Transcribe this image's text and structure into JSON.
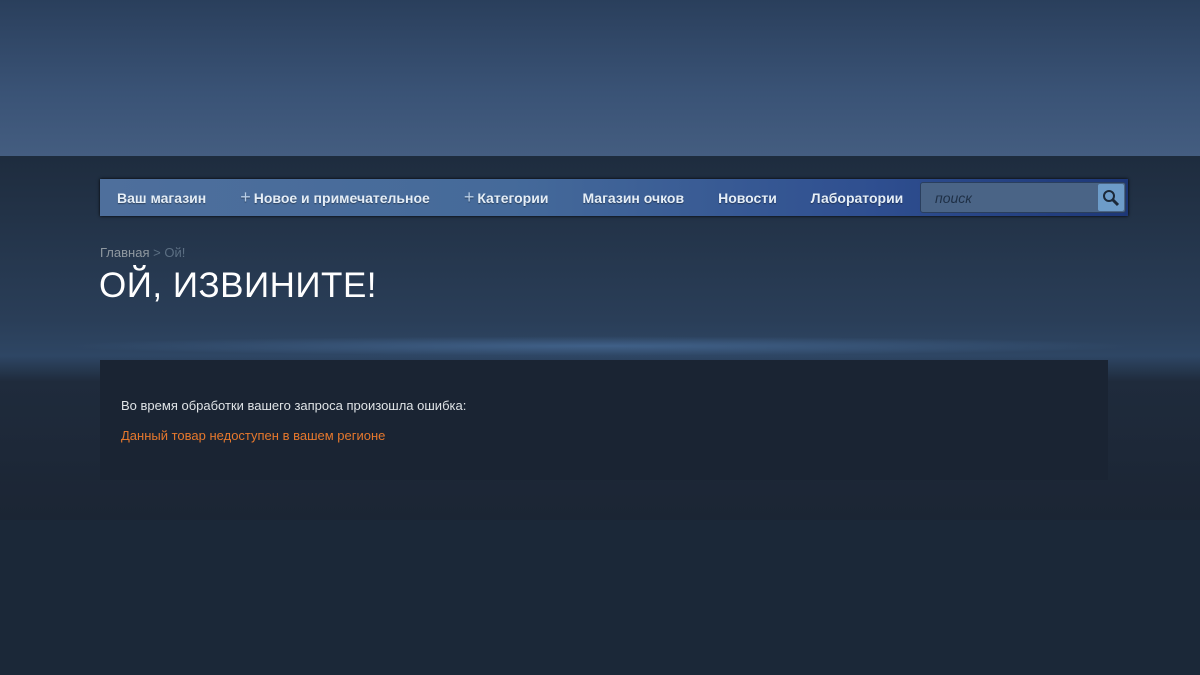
{
  "nav": {
    "items": [
      {
        "label": "Ваш магазин",
        "plus": false
      },
      {
        "label": "Новое и примечательное",
        "plus": true
      },
      {
        "label": "Категории",
        "plus": true
      },
      {
        "label": "Магазин очков",
        "plus": false
      },
      {
        "label": "Новости",
        "plus": false
      },
      {
        "label": "Лаборатории",
        "plus": false
      }
    ]
  },
  "search": {
    "placeholder": "поиск",
    "icon": "search-icon"
  },
  "breadcrumb": {
    "home": "Главная",
    "sep": ">",
    "current": "Ой!"
  },
  "title": "ОЙ, ИЗВИНИТЕ!",
  "error": {
    "message": "Во время обработки вашего запроса произошла ошибка:",
    "detail": "Данный товар недоступен в вашем регионе",
    "color": "#e6782d"
  }
}
